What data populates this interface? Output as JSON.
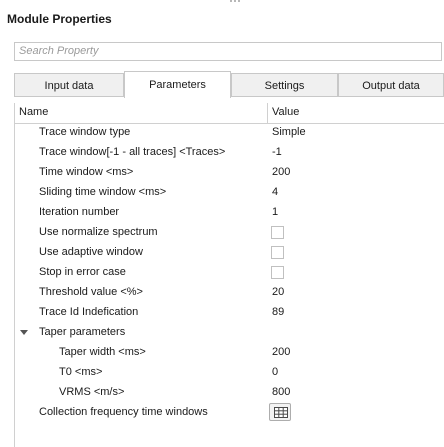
{
  "window": {
    "title": "Module Properties"
  },
  "search": {
    "placeholder": "Search Property"
  },
  "tabs": [
    "Input data",
    "Parameters",
    "Settings",
    "Output data"
  ],
  "active_tab": "Parameters",
  "grid": {
    "headers": {
      "name": "Name",
      "value": "Value"
    },
    "rows": {
      "trace_window_type": {
        "name": "Trace window type",
        "value": "Simple"
      },
      "trace_window": {
        "name": "Trace window[-1 - all traces] <Traces>",
        "value": "-1"
      },
      "time_window": {
        "name": "Time window <ms>",
        "value": "200"
      },
      "sliding_time_window": {
        "name": "Sliding time window <ms>",
        "value": "4"
      },
      "iteration_number": {
        "name": "Iteration number",
        "value": "1"
      },
      "use_normalize_spectrum": {
        "name": "Use normalize spectrum",
        "checked": false
      },
      "use_adaptive_window": {
        "name": "Use adaptive window",
        "checked": false
      },
      "stop_in_error_case": {
        "name": "Stop in error case",
        "checked": false
      },
      "threshold_value": {
        "name": "Threshold value <%>",
        "value": "20"
      },
      "trace_id_indefication": {
        "name": "Trace Id Indefication",
        "value": "89"
      },
      "taper_parameters": {
        "name": "Taper parameters",
        "expanded": true
      },
      "taper_width": {
        "name": "Taper width <ms>",
        "value": "200"
      },
      "t0": {
        "name": "T0 <ms>",
        "value": "0"
      },
      "vrms": {
        "name": "VRMS <m/s>",
        "value": "800"
      },
      "collection_frequency": {
        "name": "Collection frequency time windows",
        "value_icon": "table-grid-icon"
      }
    }
  }
}
